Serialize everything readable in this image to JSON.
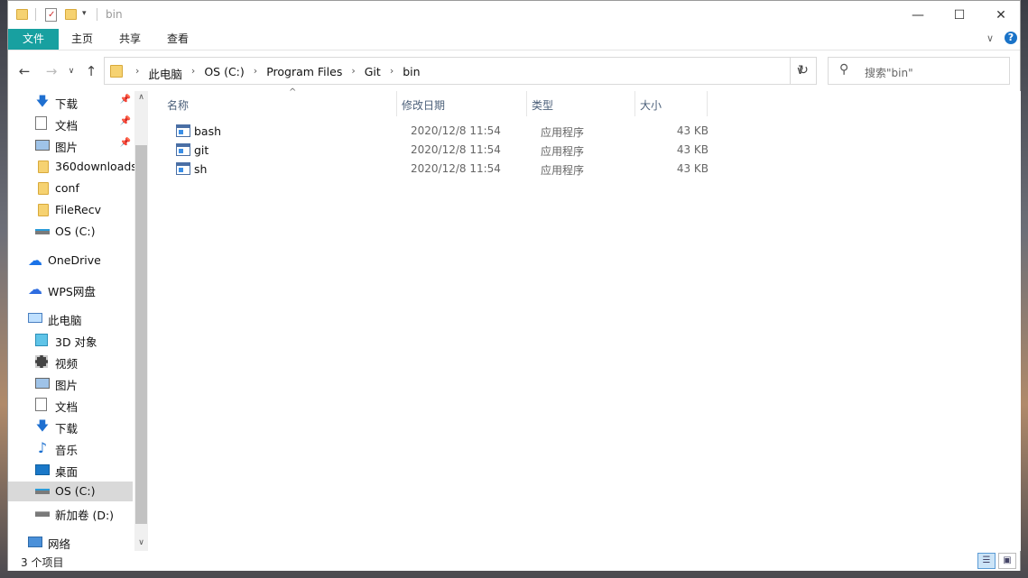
{
  "window": {
    "title": "bin",
    "controls": {
      "minimize": "—",
      "maximize": "☐",
      "close": "✕"
    }
  },
  "ribbon": {
    "tabs": [
      "文件",
      "主页",
      "共享",
      "查看"
    ],
    "expand": "∨",
    "help": "?"
  },
  "address": {
    "crumbs": [
      "此电脑",
      "OS (C:)",
      "Program Files",
      "Git",
      "bin"
    ],
    "search_placeholder": "搜索\"bin\""
  },
  "sidebar": {
    "quick_access": [
      {
        "label": "下载",
        "icon": "download-arrow-icon",
        "pinned": true
      },
      {
        "label": "文档",
        "icon": "document-icon",
        "pinned": true
      },
      {
        "label": "图片",
        "icon": "picture-icon",
        "pinned": true
      },
      {
        "label": "360downloads",
        "icon": "folder-icon",
        "pinned": false
      },
      {
        "label": "conf",
        "icon": "folder-icon",
        "pinned": false
      },
      {
        "label": "FileRecv",
        "icon": "folder-icon",
        "pinned": false
      },
      {
        "label": "OS (C:)",
        "icon": "drive-icon",
        "pinned": false
      }
    ],
    "onedrive": "OneDrive",
    "wps": "WPS网盘",
    "this_pc": "此电脑",
    "pc_items": [
      {
        "label": "3D 对象",
        "icon": "cube-icon"
      },
      {
        "label": "视频",
        "icon": "video-icon"
      },
      {
        "label": "图片",
        "icon": "picture-icon"
      },
      {
        "label": "文档",
        "icon": "document-icon"
      },
      {
        "label": "下载",
        "icon": "download-arrow-icon"
      },
      {
        "label": "音乐",
        "icon": "music-icon"
      },
      {
        "label": "桌面",
        "icon": "desktop-icon"
      },
      {
        "label": "OS (C:)",
        "icon": "drive-icon",
        "selected": true
      },
      {
        "label": "新加卷 (D:)",
        "icon": "drive-icon"
      }
    ],
    "network": "网络"
  },
  "columns": [
    "名称",
    "修改日期",
    "类型",
    "大小"
  ],
  "files": [
    {
      "name": "bash",
      "date": "2020/12/8 11:54",
      "type": "应用程序",
      "size": "43 KB"
    },
    {
      "name": "git",
      "date": "2020/12/8 11:54",
      "type": "应用程序",
      "size": "43 KB"
    },
    {
      "name": "sh",
      "date": "2020/12/8 11:54",
      "type": "应用程序",
      "size": "43 KB"
    }
  ],
  "status": {
    "count": "3 个项目"
  },
  "colors": {
    "file_tab": "#18a0a0",
    "selected_bg": "#d9d9d9",
    "header_text": "#4c607a"
  }
}
